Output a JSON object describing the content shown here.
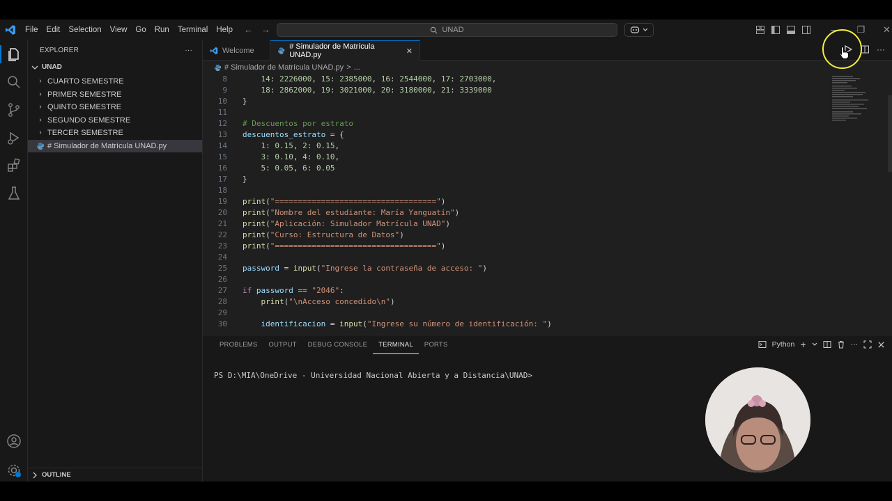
{
  "titlebar": {
    "menu": [
      "File",
      "Edit",
      "Selection",
      "View",
      "Go",
      "Run",
      "Terminal",
      "Help"
    ],
    "search_text": "UNAD",
    "app_icon": "vscode-logo-icon"
  },
  "sidebar": {
    "header": "EXPLORER",
    "more": "···",
    "root": "UNAD",
    "folders": [
      "CUARTO SEMESTRE",
      "PRIMER SEMESTRE",
      "QUINTO SEMESTRE",
      "SEGUNDO SEMESTRE",
      "TERCER SEMESTRE"
    ],
    "file": "# Simulador de Matrícula UNAD.py",
    "outline": "OUTLINE"
  },
  "tabs": {
    "welcome": "Welcome",
    "active": "# Simulador de Matrícula UNAD.py",
    "close": "✕"
  },
  "breadcrumbs": {
    "file": "# Simulador de Matrícula UNAD.py",
    "sep": ">",
    "rest": "..."
  },
  "code": [
    {
      "n": "8",
      "t": "    14: 2226000, 15: 2385000, 16: 2544000, 17: 2703000,"
    },
    {
      "n": "9",
      "t": "    18: 2862000, 19: 3021000, 20: 3180000, 21: 3339000"
    },
    {
      "n": "10",
      "t": "}"
    },
    {
      "n": "11",
      "t": ""
    },
    {
      "n": "12",
      "t": "# Descuentos por estrato"
    },
    {
      "n": "13",
      "t": "descuentos_estrato = {"
    },
    {
      "n": "14",
      "t": "    1: 0.15, 2: 0.15,"
    },
    {
      "n": "15",
      "t": "    3: 0.10, 4: 0.10,"
    },
    {
      "n": "16",
      "t": "    5: 0.05, 6: 0.05"
    },
    {
      "n": "17",
      "t": "}"
    },
    {
      "n": "18",
      "t": ""
    },
    {
      "n": "19",
      "t": "print(\"===================================\")"
    },
    {
      "n": "20",
      "t": "print(\"Nombre del estudiante: María Yanguatín\")"
    },
    {
      "n": "21",
      "t": "print(\"Aplicación: Simulador Matrícula UNAD\")"
    },
    {
      "n": "22",
      "t": "print(\"Curso: Estructura de Datos\")"
    },
    {
      "n": "23",
      "t": "print(\"===================================\")"
    },
    {
      "n": "24",
      "t": ""
    },
    {
      "n": "25",
      "t": "password = input(\"Ingrese la contraseña de acceso: \")"
    },
    {
      "n": "26",
      "t": ""
    },
    {
      "n": "27",
      "t": "if password == \"2046\":"
    },
    {
      "n": "28",
      "t": "    print(\"\\nAcceso concedido\\n\")"
    },
    {
      "n": "29",
      "t": ""
    },
    {
      "n": "30",
      "t": "    identificacion = input(\"Ingrese su número de identificación: \")"
    }
  ],
  "panel": {
    "tabs": [
      "PROBLEMS",
      "OUTPUT",
      "DEBUG CONSOLE",
      "TERMINAL",
      "PORTS"
    ],
    "active_tab": "TERMINAL",
    "shell": "Python",
    "prompt": "PS D:\\MIA\\OneDrive - Universidad Nacional Abierta y a Distancia\\UNAD>"
  },
  "colors": {
    "accent": "#0078d4",
    "keyword": "#c586c0",
    "string": "#ce9178",
    "comment": "#6a9955",
    "variable": "#9cdcfe",
    "function": "#dcdcaa",
    "number": "#b5cea8",
    "cursor_ring": "#f4ef3a"
  }
}
